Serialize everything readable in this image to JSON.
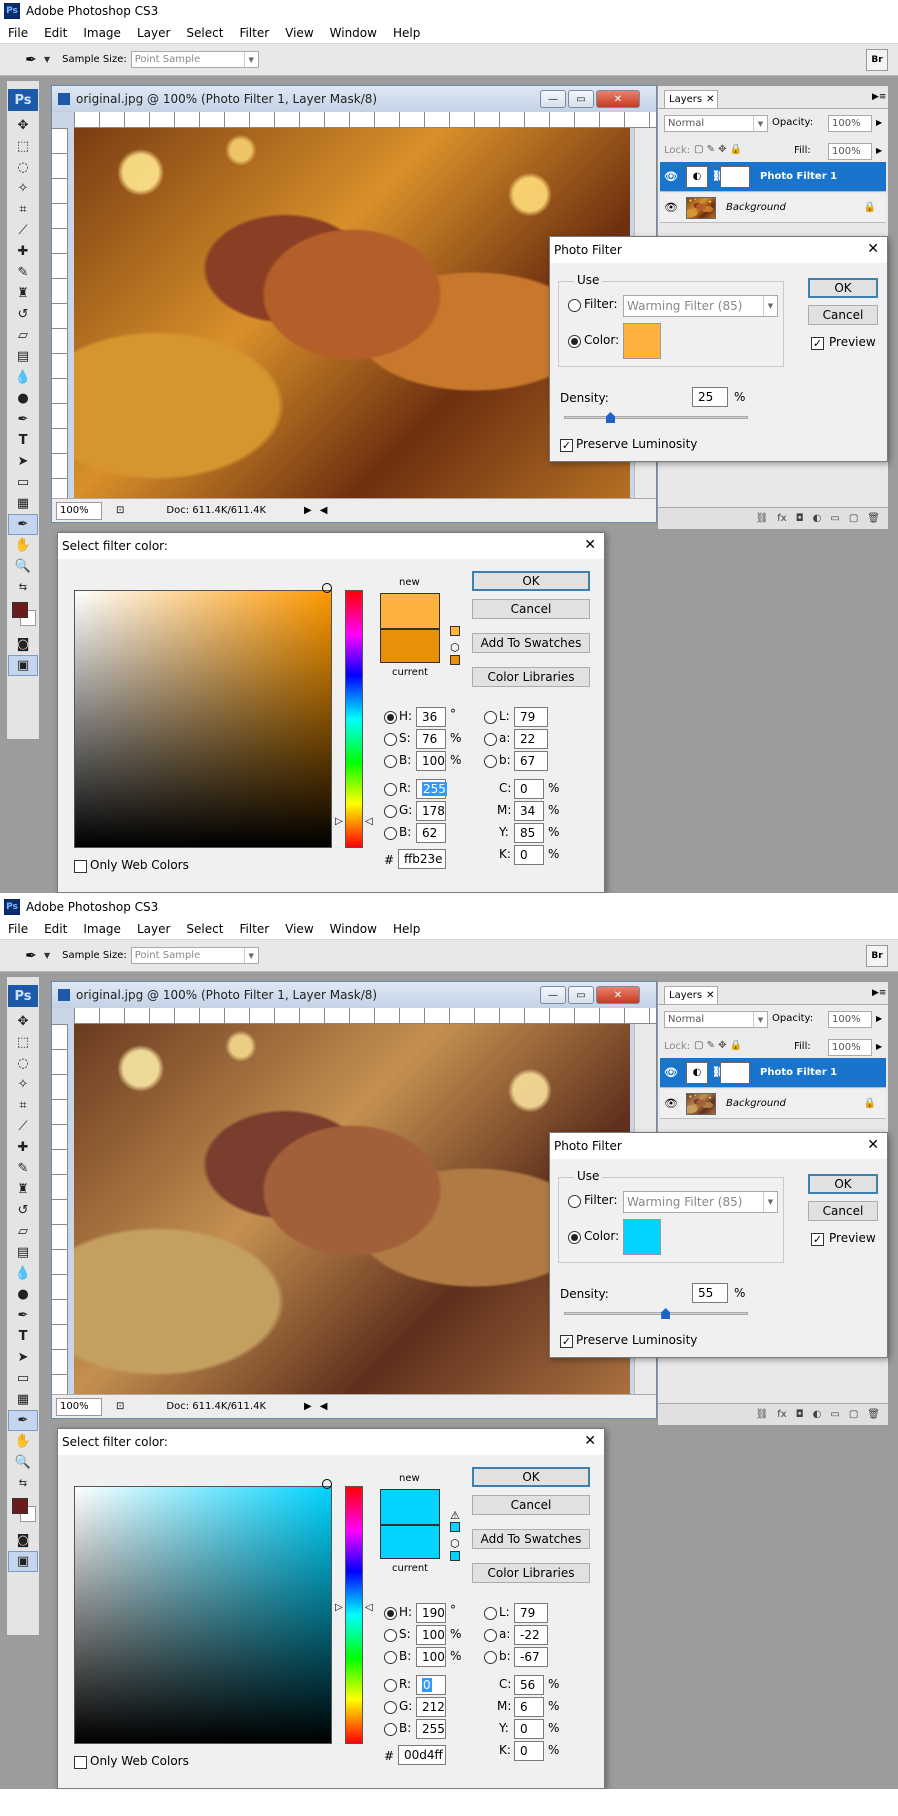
{
  "app": {
    "title": "Adobe Photoshop CS3",
    "logo": "Ps"
  },
  "menu": [
    "File",
    "Edit",
    "Image",
    "Layer",
    "Select",
    "Filter",
    "View",
    "Window",
    "Help"
  ],
  "options": {
    "sample_size_label": "Sample Size:",
    "sample_size_value": "Point Sample",
    "bridge": "Br"
  },
  "toolbox_logo": "Ps",
  "document": {
    "title": "original.jpg @ 100% (Photo Filter 1, Layer Mask/8)",
    "zoom": "100%",
    "doc_info": "Doc: 611.4K/611.4K"
  },
  "layers": {
    "tab": "Layers",
    "blend_mode": "Normal",
    "opacity_label": "Opacity:",
    "opacity": "100%",
    "lock_label": "Lock:",
    "fill_label": "Fill:",
    "fill": "100%",
    "items": [
      {
        "name": "Photo Filter 1"
      },
      {
        "name": "Background"
      }
    ]
  },
  "photo_filter": {
    "title": "Photo Filter",
    "use_label": "Use",
    "filter_label": "Filter:",
    "filter_value": "Warming Filter (85)",
    "color_label": "Color:",
    "density_label": "Density:",
    "percent": "%",
    "preserve_label": "Preserve Luminosity",
    "ok": "OK",
    "cancel": "Cancel",
    "preview": "Preview"
  },
  "color_picker": {
    "title": "Select filter color:",
    "new_label": "new",
    "current_label": "current",
    "ok": "OK",
    "cancel": "Cancel",
    "add_swatches": "Add To Swatches",
    "color_libraries": "Color Libraries",
    "only_web": "Only Web Colors",
    "labels": {
      "H": "H:",
      "S": "S:",
      "B": "B:",
      "R": "R:",
      "G": "G:",
      "Bb": "B:",
      "L": "L:",
      "a": "a:",
      "b": "b:",
      "C": "C:",
      "M": "M:",
      "Y": "Y:",
      "K": "K:",
      "hash": "#",
      "deg": "°",
      "pct": "%"
    }
  },
  "state1": {
    "density": "25",
    "density_fraction": 0.25,
    "filter_color": "#ffb23e",
    "hue_color": "#ff9900",
    "new_color": "#ffb23e",
    "current_color": "#e8900a",
    "H": "36",
    "S": "76",
    "B": "100",
    "R": "255",
    "G": "178",
    "Bv": "62",
    "L": "79",
    "a": "22",
    "b": "67",
    "C": "0",
    "M": "34",
    "Y": "85",
    "K": "0",
    "hex": "ffb23e"
  },
  "state2": {
    "density": "55",
    "density_fraction": 0.55,
    "filter_color": "#00d4ff",
    "hue_color": "#00d4ff",
    "new_color": "#00d4ff",
    "current_color": "#00d4ff",
    "H": "190",
    "S": "100",
    "B": "100",
    "R": "0",
    "G": "212",
    "Bv": "255",
    "L": "79",
    "a": "-22",
    "b": "-67",
    "C": "56",
    "M": "6",
    "Y": "0",
    "K": "0",
    "hex": "00d4ff"
  }
}
